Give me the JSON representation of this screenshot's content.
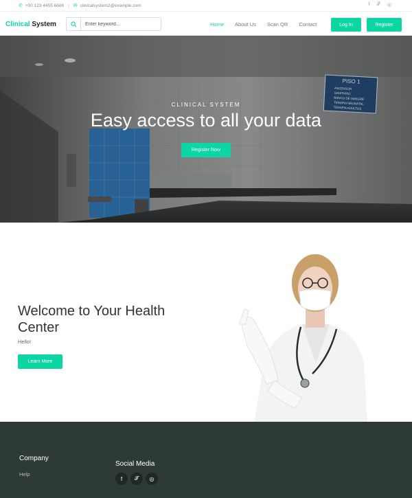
{
  "topbar": {
    "phone": "+00 123 4455 6666",
    "email": "clinicalsystem2@example.com",
    "social_icons": [
      "facebook-icon",
      "twitter-icon",
      "instagram-icon"
    ]
  },
  "nav": {
    "brand_accent": "Clinical",
    "brand_rest": " System",
    "search_placeholder": "Enter keyword...",
    "menu": [
      "Home",
      "About Us",
      "Scan QR",
      "Contact"
    ],
    "active_menu": "Home",
    "login_label": "Log In",
    "register_label": "Register"
  },
  "hero": {
    "subtitle": "CLINICAL SYSTEM",
    "title": "Easy access to all your data",
    "cta_label": "Register Now",
    "sign_title": "PISO 1",
    "sign_lines": [
      "ASCENSOR",
      "SANITARIO",
      "BANCO DE SANGRE",
      "TERAPIA NEONATAL",
      "TERAPIA ADULTOS"
    ]
  },
  "welcome": {
    "title": "Welcome to Your Health Center",
    "text": "Hello!",
    "cta_label": "Learn More"
  },
  "footer": {
    "company_title": "Company",
    "help_link": "Help",
    "social_title": "Social Media",
    "social_icons": [
      "facebook-icon",
      "twitter-icon",
      "instagram-icon"
    ]
  },
  "colors": {
    "accent": "#0bd6a4",
    "footer_bg": "#2e3a37"
  }
}
